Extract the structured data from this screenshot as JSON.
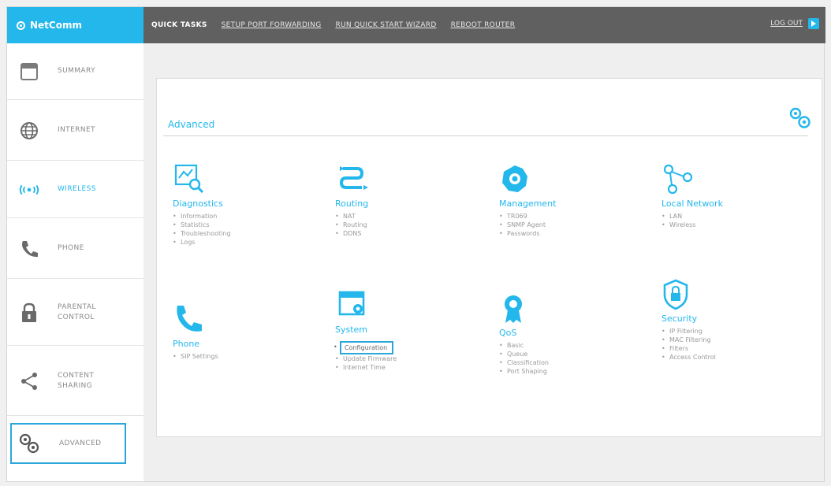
{
  "brand": {
    "name": "NetComm"
  },
  "topnav": {
    "items": [
      {
        "label": "QUICK TASKS"
      },
      {
        "label": "SETUP PORT FORWARDING"
      },
      {
        "label": "RUN QUICK START WIZARD"
      },
      {
        "label": "REBOOT ROUTER"
      }
    ],
    "logout": "LOG OUT"
  },
  "sidebar": {
    "items": [
      {
        "label": "SUMMARY",
        "icon": "summary-icon"
      },
      {
        "label": "INTERNET",
        "icon": "globe-icon"
      },
      {
        "label": "WIRELESS",
        "icon": "wireless-icon"
      },
      {
        "label": "PHONE",
        "icon": "phone-icon"
      },
      {
        "label": "PARENTAL CONTROL",
        "icon": "lock-icon"
      },
      {
        "label": "CONTENT SHARING",
        "icon": "share-icon"
      },
      {
        "label": "ADVANCED",
        "icon": "gears-icon"
      }
    ]
  },
  "main": {
    "title": "Advanced",
    "groups": [
      {
        "title": "Diagnostics",
        "icon": "diagnostics-icon",
        "items": [
          "Information",
          "Statistics",
          "Troubleshooting",
          "Logs"
        ]
      },
      {
        "title": "Routing",
        "icon": "routing-icon",
        "items": [
          "NAT",
          "Routing",
          "DDNS"
        ]
      },
      {
        "title": "Management",
        "icon": "management-icon",
        "items": [
          "TR069",
          "SNMP Agent",
          "Passwords"
        ]
      },
      {
        "title": "Local Network",
        "icon": "local-network-icon",
        "items": [
          "LAN",
          "Wireless"
        ]
      },
      {
        "title": "Phone",
        "icon": "phone-icon",
        "items": [
          "SIP Settings"
        ]
      },
      {
        "title": "System",
        "icon": "system-icon",
        "items": [
          "Configuration",
          "Update Firmware",
          "Internet Time"
        ]
      },
      {
        "title": "QoS",
        "icon": "qos-icon",
        "items": [
          "Basic",
          "Queue",
          "Classification",
          "Port Shaping"
        ]
      },
      {
        "title": "Security",
        "icon": "security-icon",
        "items": [
          "IP Filtering",
          "MAC Filtering",
          "Filters",
          "Access Control"
        ]
      }
    ]
  },
  "colors": {
    "accent": "#23b7ec",
    "topbar": "#606060",
    "background": "#efefef"
  }
}
